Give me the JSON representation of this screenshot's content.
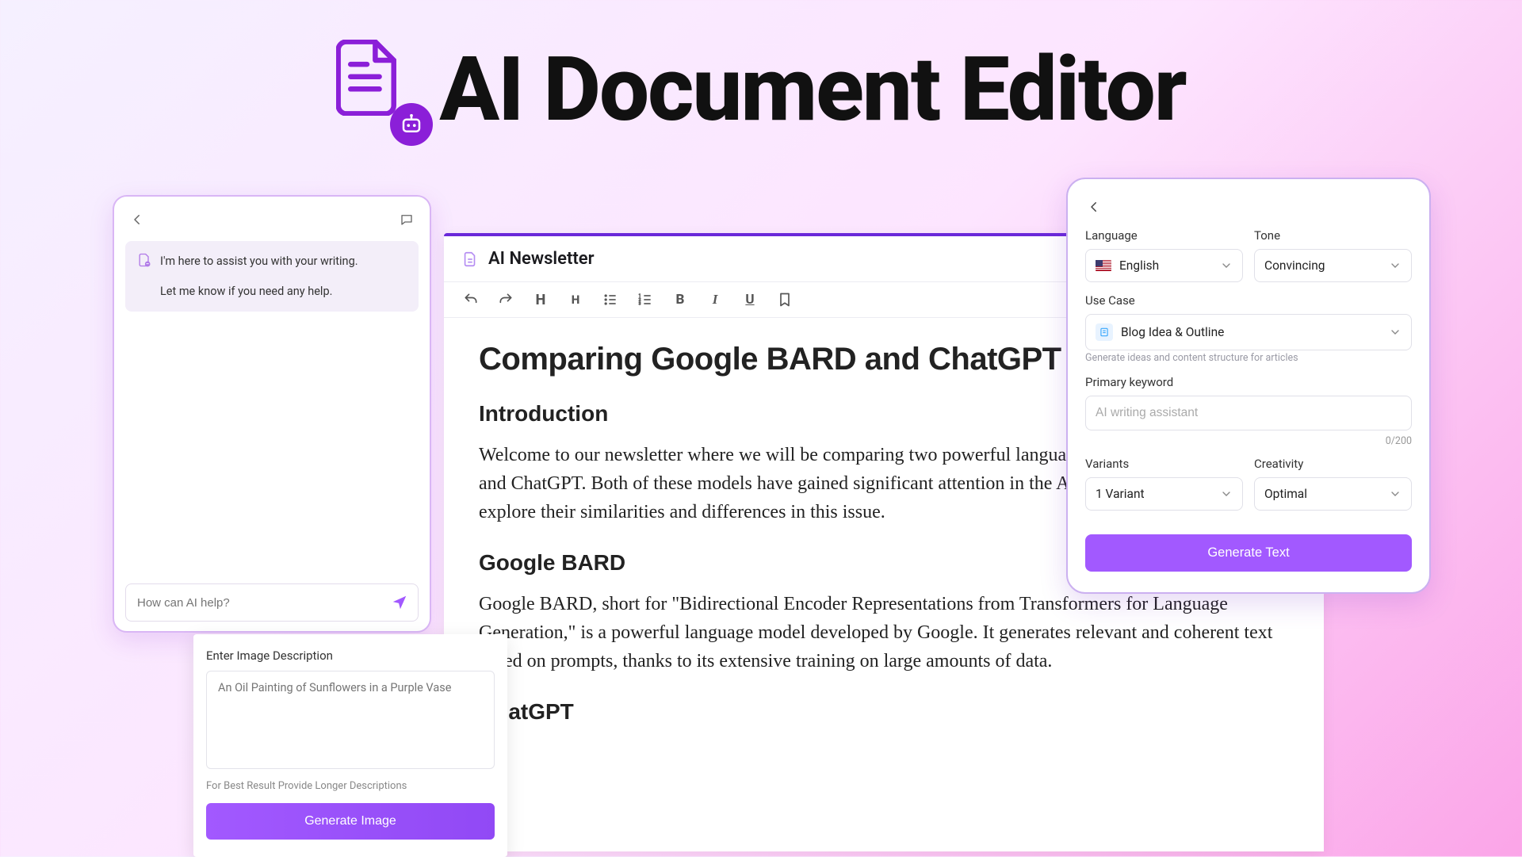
{
  "hero": {
    "title": "AI Document Editor"
  },
  "chat": {
    "assistant_line1": "I'm here to assist you with your writing.",
    "assistant_line2": "Let me know if you need any help.",
    "input_placeholder": "How can AI help?"
  },
  "document": {
    "tab_title": "AI Newsletter",
    "h1": "Comparing Google BARD and ChatGPT",
    "intro_heading": "Introduction",
    "intro_body": "Welcome to our newsletter where we will be comparing two powerful language models, Google BARD and ChatGPT. Both of these models have gained significant attention in the AI community, and we will explore their similarities and differences in this issue.",
    "bard_heading": "Google BARD",
    "bard_body": "Google BARD, short for \"Bidirectional Encoder Representations from Transformers for Language Generation,\" is a powerful language model developed by Google. It generates relevant and coherent text based on prompts, thanks to its extensive training on large amounts of data.",
    "gpt_heading": "ChatGPT"
  },
  "image_gen": {
    "label": "Enter Image Description",
    "placeholder": "An Oil Painting of Sunflowers in a Purple Vase",
    "hint": "For Best Result Provide Longer Descriptions",
    "button": "Generate Image"
  },
  "settings": {
    "language_label": "Language",
    "language_value": "English",
    "tone_label": "Tone",
    "tone_value": "Convincing",
    "usecase_label": "Use Case",
    "usecase_value": "Blog Idea & Outline",
    "usecase_helper": "Generate ideas and content structure for articles",
    "keyword_label": "Primary keyword",
    "keyword_placeholder": "AI writing assistant",
    "keyword_counter": "0/200",
    "variants_label": "Variants",
    "variants_value": "1 Variant",
    "creativity_label": "Creativity",
    "creativity_value": "Optimal",
    "button": "Generate Text"
  }
}
